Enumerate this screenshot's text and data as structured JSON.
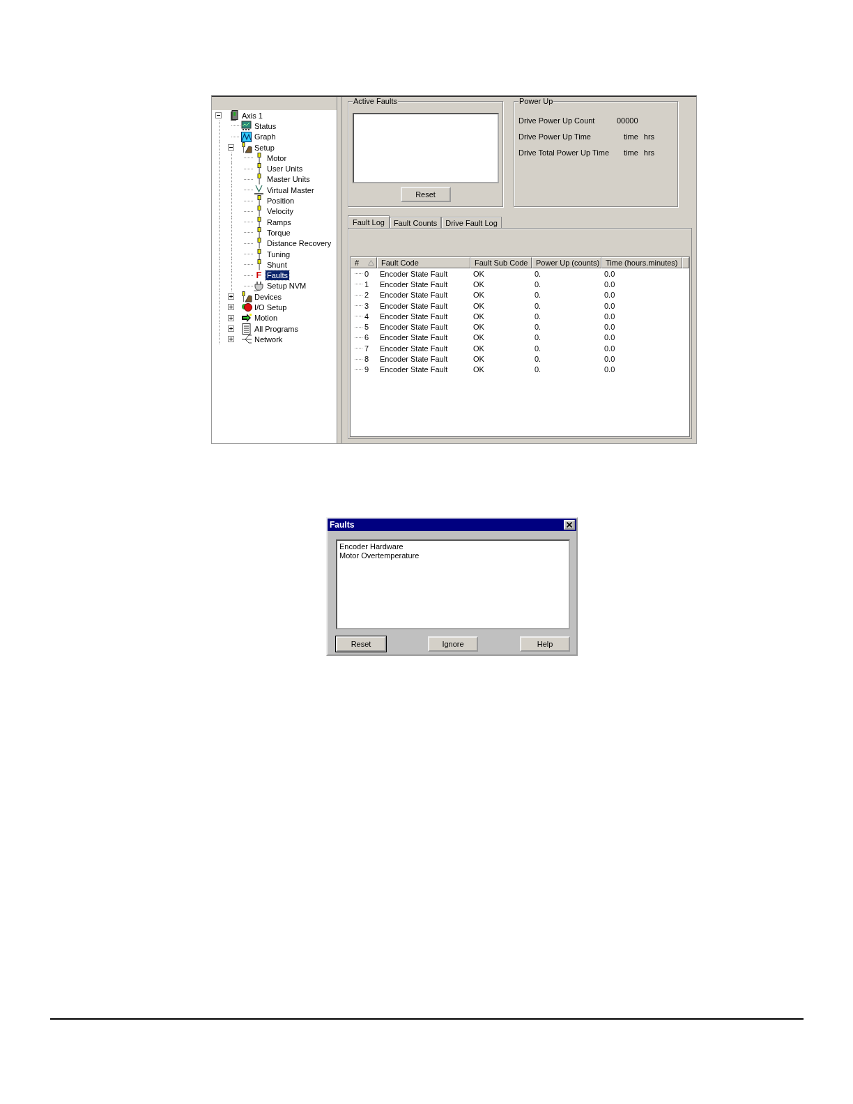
{
  "fault_window": {
    "tree": [
      {
        "label": "Axis 1",
        "kind": "drive",
        "selected": false,
        "expanded": true,
        "children": [
          {
            "label": "Status",
            "kind": "status",
            "selected": false
          },
          {
            "label": "Graph",
            "kind": "graph",
            "selected": false
          },
          {
            "label": "Setup",
            "kind": "setup",
            "selected": false,
            "expanded": true,
            "children": [
              {
                "label": "Motor",
                "kind": "post",
                "selected": false
              },
              {
                "label": "User Units",
                "kind": "post",
                "selected": false
              },
              {
                "label": "Master Units",
                "kind": "post",
                "selected": false
              },
              {
                "label": "Virtual Master",
                "kind": "virtual",
                "selected": false
              },
              {
                "label": "Position",
                "kind": "post",
                "selected": false
              },
              {
                "label": "Velocity",
                "kind": "post",
                "selected": false
              },
              {
                "label": "Ramps",
                "kind": "post",
                "selected": false
              },
              {
                "label": "Torque",
                "kind": "post",
                "selected": false
              },
              {
                "label": "Distance Recovery",
                "kind": "post",
                "selected": false
              },
              {
                "label": "Tuning",
                "kind": "post",
                "selected": false
              },
              {
                "label": "Shunt",
                "kind": "post",
                "selected": false
              },
              {
                "label": "Faults",
                "kind": "letter",
                "icon_text": "F",
                "selected": true
              },
              {
                "label": "Setup NVM",
                "kind": "plug",
                "selected": false
              }
            ]
          },
          {
            "label": "Devices",
            "kind": "setup",
            "selected": false,
            "expanded": false
          },
          {
            "label": "I/O Setup",
            "kind": "ball",
            "selected": false,
            "expanded": false
          },
          {
            "label": "Motion",
            "kind": "motion",
            "selected": false,
            "expanded": false
          },
          {
            "label": "All Programs",
            "kind": "document",
            "selected": false,
            "expanded": false
          },
          {
            "label": "Network",
            "kind": "network",
            "selected": false,
            "expanded": false
          }
        ]
      }
    ],
    "active_faults": {
      "title": "Active Faults",
      "reset_button": "Reset"
    },
    "power_up": {
      "title": "Power Up",
      "rows": [
        {
          "label": "Drive Power Up Count",
          "value": "00000"
        },
        {
          "label": "Drive Power Up Time",
          "value": "time",
          "unit": "hrs"
        },
        {
          "label": "Drive Total Power Up Time",
          "value": "time",
          "unit": "hrs"
        }
      ]
    },
    "tabs": [
      {
        "label": "Fault Log",
        "selected": true
      },
      {
        "label": "Fault Counts",
        "selected": false
      },
      {
        "label": "Drive Fault Log",
        "selected": false
      }
    ],
    "fault_log": {
      "columns": [
        {
          "label": "#",
          "sorted": true
        },
        {
          "label": "Fault Code",
          "sorted": false
        },
        {
          "label": "Fault Sub Code",
          "sorted": false
        },
        {
          "label": "Power Up (counts)",
          "sorted": false
        },
        {
          "label": "Time (hours.minutes)",
          "sorted": false
        }
      ],
      "rows": [
        {
          "index": "0",
          "fault_code": "Encoder State Fault",
          "sub_code": "OK",
          "power_up": "0.",
          "time": "0.0"
        },
        {
          "index": "1",
          "fault_code": "Encoder State Fault",
          "sub_code": "OK",
          "power_up": "0.",
          "time": "0.0"
        },
        {
          "index": "2",
          "fault_code": "Encoder State Fault",
          "sub_code": "OK",
          "power_up": "0.",
          "time": "0.0"
        },
        {
          "index": "3",
          "fault_code": "Encoder State Fault",
          "sub_code": "OK",
          "power_up": "0.",
          "time": "0.0"
        },
        {
          "index": "4",
          "fault_code": "Encoder State Fault",
          "sub_code": "OK",
          "power_up": "0.",
          "time": "0.0"
        },
        {
          "index": "5",
          "fault_code": "Encoder State Fault",
          "sub_code": "OK",
          "power_up": "0.",
          "time": "0.0"
        },
        {
          "index": "6",
          "fault_code": "Encoder State Fault",
          "sub_code": "OK",
          "power_up": "0.",
          "time": "0.0"
        },
        {
          "index": "7",
          "fault_code": "Encoder State Fault",
          "sub_code": "OK",
          "power_up": "0.",
          "time": "0.0"
        },
        {
          "index": "8",
          "fault_code": "Encoder State Fault",
          "sub_code": "OK",
          "power_up": "0.",
          "time": "0.0"
        },
        {
          "index": "9",
          "fault_code": "Encoder State Fault",
          "sub_code": "OK",
          "power_up": "0.",
          "time": "0.0"
        }
      ]
    }
  },
  "faults_dialog": {
    "title": "Faults",
    "items": [
      "Encoder Hardware",
      "Motor Overtemperature"
    ],
    "buttons": [
      {
        "label": "Reset",
        "default": true
      },
      {
        "label": "Ignore",
        "default": false
      },
      {
        "label": "Help",
        "default": false
      }
    ]
  }
}
